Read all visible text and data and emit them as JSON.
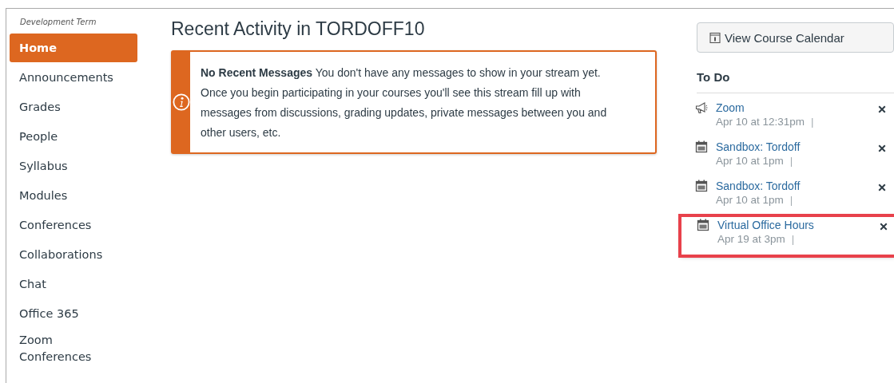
{
  "sidebar": {
    "term": "Development Term",
    "items": [
      {
        "label": "Home",
        "selected": true
      },
      {
        "label": "Announcements",
        "selected": false
      },
      {
        "label": "Grades",
        "selected": false
      },
      {
        "label": "People",
        "selected": false
      },
      {
        "label": "Syllabus",
        "selected": false
      },
      {
        "label": "Modules",
        "selected": false
      },
      {
        "label": "Conferences",
        "selected": false
      },
      {
        "label": "Collaborations",
        "selected": false
      },
      {
        "label": "Chat",
        "selected": false
      },
      {
        "label": "Office 365",
        "selected": false
      },
      {
        "label": "Zoom Conferences",
        "selected": false
      }
    ]
  },
  "main": {
    "title": "Recent Activity in TORDOFF10",
    "alert": {
      "text": "**No Recent Messages**  You don't have any messages to show in your stream yet. Once you begin participating in your courses you'll see this stream fill up with messages from discussions, grading updates, private messages between you and other users, etc."
    }
  },
  "right": {
    "calendar_button": "View Course Calendar",
    "todo_title": "To Do",
    "todos": [
      {
        "kind": "announcement",
        "title": "Zoom",
        "date": "Apr 10 at 12:31pm",
        "separator": "|",
        "highlighted": false
      },
      {
        "kind": "event",
        "title": "Sandbox: Tordoff",
        "date": "Apr 10 at 1pm",
        "separator": "|",
        "highlighted": false
      },
      {
        "kind": "event",
        "title": "Sandbox: Tordoff",
        "date": "Apr 10 at 1pm",
        "separator": "|",
        "highlighted": false
      },
      {
        "kind": "event",
        "title": "Virtual Office Hours",
        "date": "Apr 19 at 3pm",
        "separator": "|",
        "highlighted": true
      }
    ]
  }
}
